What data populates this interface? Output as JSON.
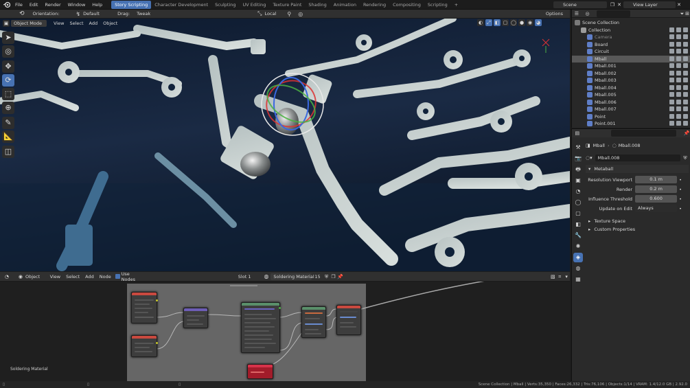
{
  "menu": [
    "File",
    "Edit",
    "Render",
    "Window",
    "Help"
  ],
  "workspace_tabs": [
    {
      "label": "Story Scripting",
      "active": true
    },
    {
      "label": "Character Development",
      "active": false
    },
    {
      "label": "Sculpting",
      "active": false
    },
    {
      "label": "UV Editing",
      "active": false
    },
    {
      "label": "Texture Paint",
      "active": false
    },
    {
      "label": "Shading",
      "active": false
    },
    {
      "label": "Animation",
      "active": false
    },
    {
      "label": "Rendering",
      "active": false
    },
    {
      "label": "Compositing",
      "active": false
    },
    {
      "label": "Scripting",
      "active": false
    }
  ],
  "add_tab": "+",
  "scene": "Scene",
  "view_layer": "View Layer",
  "toolbar": {
    "orientation_label": "Orientation:",
    "orientation_value": "Default",
    "drag_label": "Drag:",
    "drag_value": "Tweak",
    "pivot": "Local",
    "options": "Options"
  },
  "viewport_header": {
    "mode": "Object Mode",
    "menus": [
      "View",
      "Select",
      "Add",
      "Object"
    ]
  },
  "outliner": {
    "items": [
      {
        "name": "Scene Collection",
        "indent": 0,
        "color": "#8a8a8a",
        "selected": false
      },
      {
        "name": "Collection",
        "indent": 1,
        "color": "#8a8a8a",
        "selected": false
      },
      {
        "name": "Camera",
        "indent": 2,
        "color": "#7f7f7f",
        "selected": false,
        "dim": true
      },
      {
        "name": "Board",
        "indent": 2,
        "color": "#e5a46a",
        "selected": false
      },
      {
        "name": "Circuit",
        "indent": 2,
        "color": "#e5a46a",
        "selected": false
      },
      {
        "name": "Mball",
        "indent": 2,
        "color": "#e5a46a",
        "selected": true
      },
      {
        "name": "Mball.001",
        "indent": 2,
        "color": "#e5a46a",
        "selected": false
      },
      {
        "name": "Mball.002",
        "indent": 2,
        "color": "#e5a46a",
        "selected": false
      },
      {
        "name": "Mball.003",
        "indent": 2,
        "color": "#e5a46a",
        "selected": false
      },
      {
        "name": "Mball.004",
        "indent": 2,
        "color": "#e5a46a",
        "selected": false
      },
      {
        "name": "Mball.005",
        "indent": 2,
        "color": "#e5a46a",
        "selected": false
      },
      {
        "name": "Mball.006",
        "indent": 2,
        "color": "#e5a46a",
        "selected": false
      },
      {
        "name": "Mball.007",
        "indent": 2,
        "color": "#e5a46a",
        "selected": false
      },
      {
        "name": "Point",
        "indent": 2,
        "color": "#e5a46a",
        "selected": false
      },
      {
        "name": "Point.001",
        "indent": 2,
        "color": "#e5a46a",
        "selected": false
      }
    ]
  },
  "properties": {
    "object_name": "Mball",
    "data_name": "Mball.008",
    "datablock": "Mball.008",
    "panel_title": "Metaball",
    "fields": [
      {
        "label": "Resolution Viewport",
        "value": "0.1 m"
      },
      {
        "label": "Render",
        "value": "0.2 m"
      },
      {
        "label": "Influence Threshold",
        "value": "0.600"
      }
    ],
    "update_label": "Update on Edit",
    "update_value": "Always",
    "collapsed_panels": [
      "Texture Space",
      "Custom Properties"
    ]
  },
  "node_editor": {
    "type": "Object",
    "menus": [
      "View",
      "Select",
      "Add",
      "Node"
    ],
    "use_nodes": "Use Nodes",
    "slot": "Slot 1",
    "material": "Soldering Material",
    "users": "15",
    "label": "Soldering Material"
  },
  "status_bar": "Scene Collection | Mball | Verts:35,350 | Faces:26,332 | Tris:76,106 | Objects:1/14 | VRAM: 1.4/12.0 GB | 2.92.0"
}
